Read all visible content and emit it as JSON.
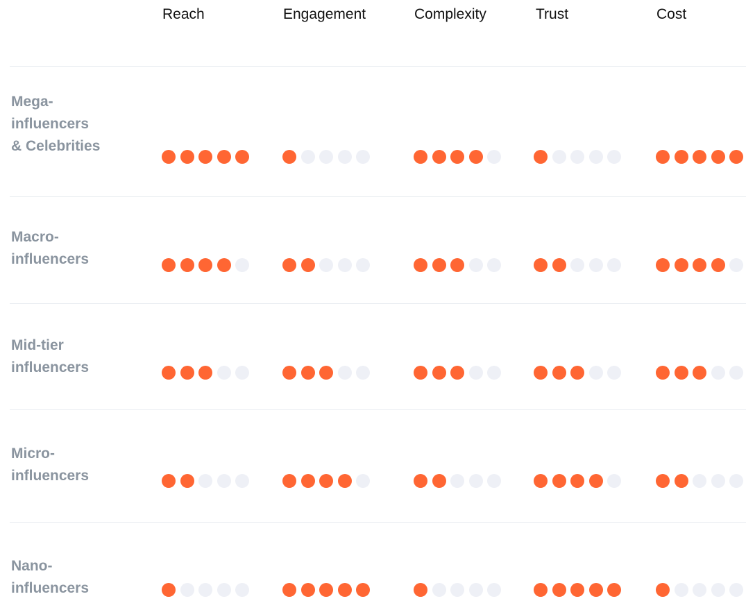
{
  "chart_data": {
    "type": "table",
    "columns": [
      "Reach",
      "Engagement",
      "Complexity",
      "Trust",
      "Cost"
    ],
    "rows": [
      {
        "label_lines": [
          "Mega-",
          "influencers",
          "& Celebrities"
        ],
        "ratings": [
          5,
          1,
          4,
          1,
          5
        ]
      },
      {
        "label_lines": [
          "Macro-",
          "influencers"
        ],
        "ratings": [
          4,
          2,
          3,
          2,
          4
        ]
      },
      {
        "label_lines": [
          "Mid-tier",
          "influencers"
        ],
        "ratings": [
          3,
          3,
          3,
          3,
          3
        ]
      },
      {
        "label_lines": [
          "Micro-",
          "influencers"
        ],
        "ratings": [
          2,
          4,
          2,
          4,
          2
        ]
      },
      {
        "label_lines": [
          "Nano-",
          "influencers"
        ],
        "ratings": [
          1,
          5,
          1,
          5,
          1
        ]
      }
    ],
    "scale_max": 5
  },
  "colors": {
    "filled": "#ff6633",
    "empty": "#eef0f6"
  }
}
